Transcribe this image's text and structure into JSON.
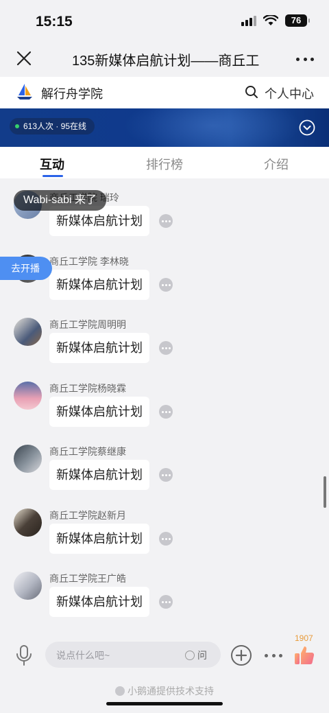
{
  "status_bar": {
    "time": "15:15",
    "battery": "76"
  },
  "nav": {
    "title": "135新媒体启航计划——商丘工",
    "close_icon": "close-icon",
    "more_icon": "more-horizontal-icon"
  },
  "brand": {
    "name": "解行舟学院",
    "user_center": "个人中心",
    "search_icon": "search-icon"
  },
  "banner": {
    "viewers": "613人次 · 95在线",
    "collapse_icon": "chevron-down-circle-icon"
  },
  "tabs": [
    {
      "label": "互动",
      "active": true
    },
    {
      "label": "排行榜",
      "active": false
    },
    {
      "label": "介绍",
      "active": false
    }
  ],
  "toasts": {
    "join": "Wabi-sabi 来了",
    "go_live": "去开播"
  },
  "messages": [
    {
      "name": "商丘工学院 瑞玲",
      "text": "新媒体启航计划",
      "avatar_color": "#8aa2c8"
    },
    {
      "name": "商丘工学院 李林晓",
      "text": "新媒体启航计划",
      "avatar_color": "#3a3a3a"
    },
    {
      "name": "商丘工学院周明明",
      "text": "新媒体启航计划",
      "avatar_color": "#7a6a5a"
    },
    {
      "name": "商丘工学院杨晓霖",
      "text": "新媒体启航计划",
      "avatar_color": "#d48aa0"
    },
    {
      "name": "商丘工学院蔡继康",
      "text": "新媒体启航计划",
      "avatar_color": "#55606a"
    },
    {
      "name": "商丘工学院赵新月",
      "text": "新媒体启航计划",
      "avatar_color": "#4a4038"
    },
    {
      "name": "商丘工学院王广皓",
      "text": "新媒体启航计划",
      "avatar_color": "#c9ccd4"
    }
  ],
  "bottom": {
    "placeholder": "说点什么吧~",
    "ask_label": "问",
    "like_count": "1907",
    "powered_by": "小鹅通提供技术支持"
  },
  "colors": {
    "accent": "#2b63e8",
    "banner": "#123c8a",
    "like": "#e89b3a"
  }
}
